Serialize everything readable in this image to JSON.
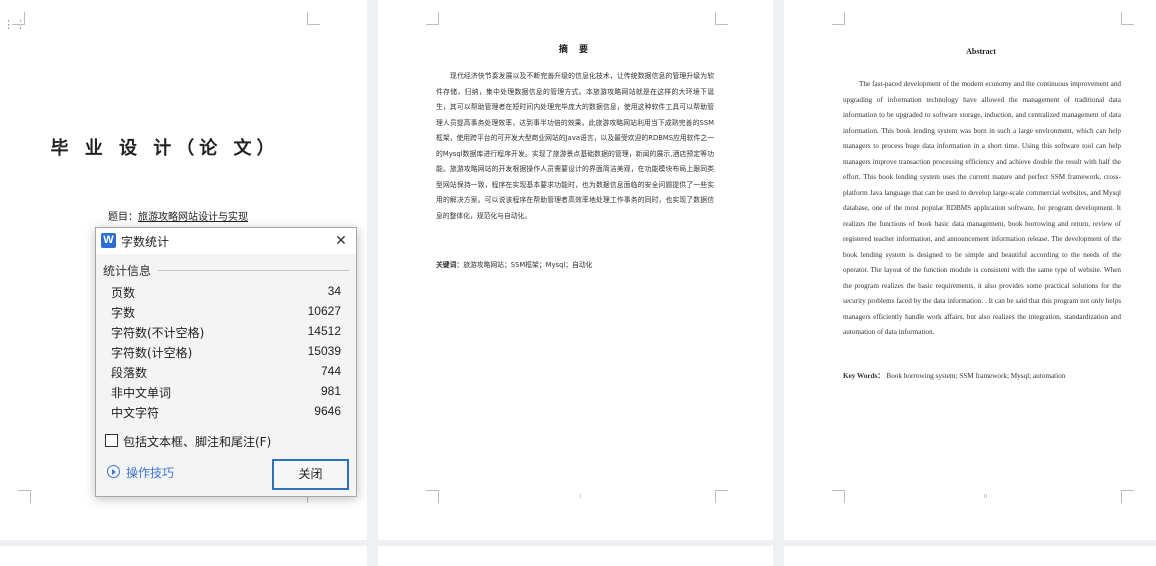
{
  "page1": {
    "thesis_title": "毕 业 设 计（论 文）",
    "topic_label": "题目：",
    "topic_value": "旅游攻略网站设计与实现"
  },
  "page2": {
    "heading": "摘 要",
    "body": "现代经济快节奏发展以及不断完善升级的信息化技术，让传统数据信息的管理升级为软件存储，归纳，集中处理数据信息的管理方式。本旅游攻略网站就是在这样的大环境下诞生，其可以帮助管理者在短时间内处理完毕庞大的数据信息，使用这种软件工具可以帮助管理人员提高事务处理效率，达到事半功倍的效果。此旅游攻略网站利用当下成熟完善的SSM框架，使用跨平台的可开发大型商业网站的Java语言，以及最受欢迎的RDBMS应用软件之一的Mysql数据库进行程序开发。实现了旅游景点基础数据的管理，新闻的展示,酒店预定等功能。旅游攻略网站的开发根据操作人员需要设计的界面简洁美观，在功能模块布局上跟同类型网站保持一致，程序在实现基本要求功能时，也为数据信息面临的安全问题提供了一些实用的解决方案。可以说该程序在帮助管理者高效率地处理工作事务的同时，也实现了数据信息的整体化，规范化与自动化。",
    "keywords_label": "关键词：",
    "keywords_value": "旅游攻略网站；SSM框架；Mysql；自动化",
    "page_number": "I"
  },
  "page3": {
    "heading": "Abstract",
    "body": "The fast-paced development of the modern economy and the continuous improvement and upgrading of information technology have allowed the management of traditional data information to be upgraded to software storage, induction, and centralized management of data information. This book lending system was born in such a large environment, which can help managers to process huge data information in a short time. Using this software tool can help managers improve transaction processing efficiency and achieve double the result with half the effort. This book lending system uses the current mature and perfect SSM framework, cross-platform Java language that can be used to develop large-scale commercial websites, and Mysql database, one of the most popular RDBMS application software, for program development. It realizes the functions of book basic data management, book borrowing and return, review of registered teacher information, and announcement information release. The development of the book lending system is designed to be simple and beautiful according to the needs of the operator. The layout of the function module is consistent with the same type of website. When the program realizes the basic requirements, it also provides some practical solutions for the security problems faced by the data information. . It can be said that this program not only helps managers efficiently handle work affairs, but also realizes the integration, standardization and automation of data information.",
    "keywords_label": "Key Words：",
    "keywords_value": "Book borrowing system; SSM framework; Mysql; automation",
    "page_number": "II"
  },
  "dialog": {
    "app_icon": "W",
    "title": "字数统计",
    "close_glyph": "✕",
    "section_label": "统计信息",
    "stats": [
      {
        "label": "页数",
        "value": "34"
      },
      {
        "label": "字数",
        "value": "10627"
      },
      {
        "label": "字符数(不计空格)",
        "value": "14512"
      },
      {
        "label": "字符数(计空格)",
        "value": "15039"
      },
      {
        "label": "段落数",
        "value": "744"
      },
      {
        "label": "非中文单词",
        "value": "981"
      },
      {
        "label": "中文字符",
        "value": "9646"
      }
    ],
    "checkbox_label": "包括文本框、脚注和尾注(F)",
    "checkbox_checked": false,
    "tips_label": "操作技巧",
    "close_button_label": "关闭"
  }
}
